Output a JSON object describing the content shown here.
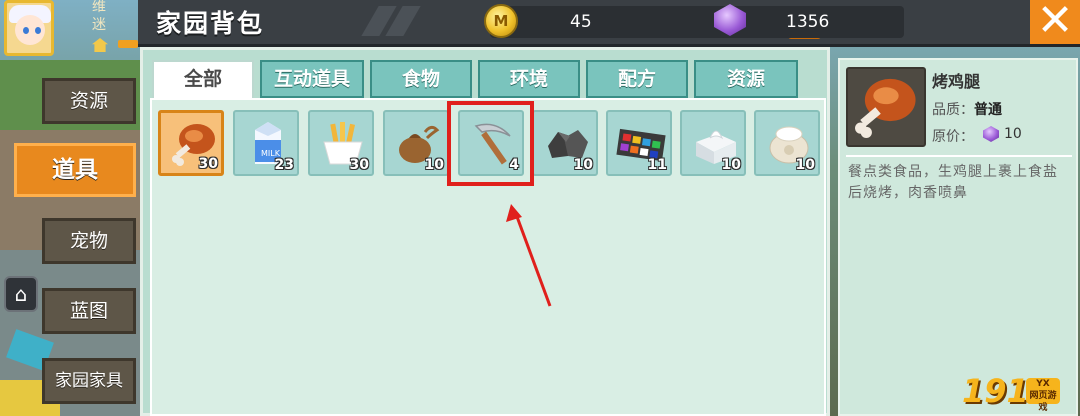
{
  "user": {
    "name_fragment": "维",
    "sub_fragment": "迷"
  },
  "header": {
    "title": "家园背包",
    "coins": {
      "icon": "coin-icon",
      "glyph": "M",
      "value": "45"
    },
    "plus_label": "+",
    "gems": {
      "icon": "gem-icon",
      "value": "1356"
    },
    "close_label": "✕"
  },
  "sidebar": {
    "items": [
      {
        "label": "资源",
        "active": false
      },
      {
        "label": "道具",
        "active": true
      },
      {
        "label": "宠物",
        "active": false
      },
      {
        "label": "蓝图",
        "active": false
      },
      {
        "label": "家园家具",
        "active": false
      }
    ],
    "home_glyph": "⌂"
  },
  "tabs": [
    {
      "label": "全部",
      "active": true
    },
    {
      "label": "互动道具",
      "active": false
    },
    {
      "label": "食物",
      "active": false
    },
    {
      "label": "环境",
      "active": false
    },
    {
      "label": "配方",
      "active": false
    },
    {
      "label": "资源",
      "active": false
    }
  ],
  "items": [
    {
      "icon": "roast-chicken-leg-icon",
      "count": "30",
      "selected": true
    },
    {
      "icon": "milk-carton-icon",
      "count": "23",
      "selected": false
    },
    {
      "icon": "fries-icon",
      "count": "30",
      "selected": false
    },
    {
      "icon": "seed-bag-icon",
      "count": "10",
      "selected": false
    },
    {
      "icon": "pickaxe-icon",
      "count": "4",
      "selected": false
    },
    {
      "icon": "coal-icon",
      "count": "10",
      "selected": false
    },
    {
      "icon": "paint-palette-icon",
      "count": "11",
      "selected": false
    },
    {
      "icon": "tissue-box-icon",
      "count": "10",
      "selected": false
    },
    {
      "icon": "flour-sack-icon",
      "count": "10",
      "selected": false
    }
  ],
  "detail": {
    "name": "烤鸡腿",
    "quality_label": "品质：",
    "quality_value": "普通",
    "price_label": "原价：",
    "price_value": "10",
    "description": "餐点类食品，生鸡腿上裹上食盐后烧烤，肉香喷鼻"
  },
  "watermark": {
    "text": "1912",
    "badge_top": "YX",
    "badge_bottom": "网页游戏"
  },
  "colors": {
    "accent_orange": "#e8891e",
    "highlight_red": "#e0201c",
    "tab_teal": "#7ac4bd",
    "panel_mint": "#b9ddd0"
  }
}
